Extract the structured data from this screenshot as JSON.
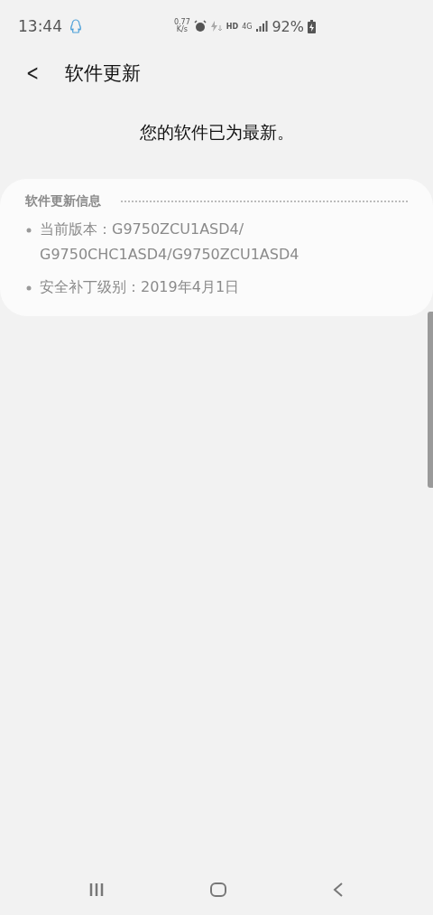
{
  "status_bar": {
    "time": "13:44",
    "speed_value": "0.77",
    "speed_unit": "K/s",
    "hd": "HD",
    "network": "4G",
    "battery": "92%"
  },
  "header": {
    "back": "<",
    "title": "软件更新"
  },
  "message": "您的软件已为最新。",
  "info_card": {
    "title": "软件更新信息",
    "items": [
      {
        "label": "当前版本：",
        "value": "G9750ZCU1ASD4/ G9750CHC1ASD4/G9750ZCU1ASD4"
      },
      {
        "label": "安全补丁级别：",
        "value": "2019年4月1日"
      }
    ]
  }
}
